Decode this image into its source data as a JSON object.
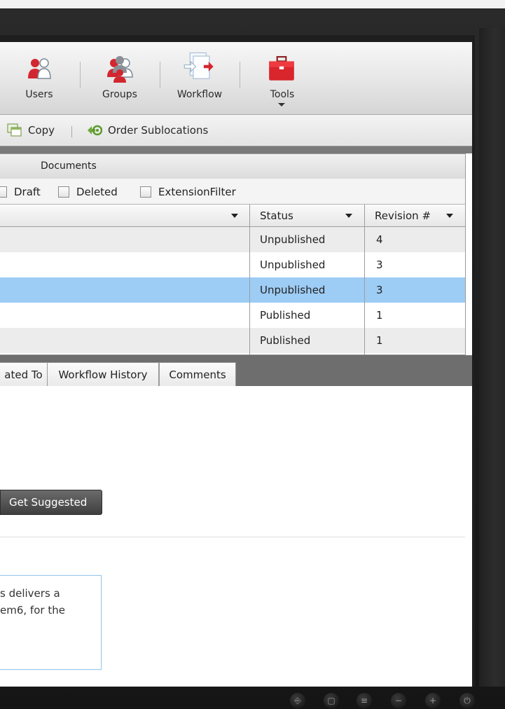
{
  "ribbon": {
    "users_label": "Users",
    "groups_label": "Groups",
    "workflow_label": "Workflow",
    "tools_label": "Tools",
    "tools_icon": "toolbox-icon",
    "users_icon": "users-icon",
    "groups_icon": "groups-icon",
    "workflow_icon": "workflow-icon"
  },
  "toolbar": {
    "copy_label": "Copy",
    "order_sublocations_label": "Order Sublocations"
  },
  "documents": {
    "header": "Documents",
    "filters": [
      {
        "label": "Draft",
        "checked": false
      },
      {
        "label": "Deleted",
        "checked": false
      },
      {
        "label": "ExtensionFilter",
        "checked": false
      }
    ],
    "columns": {
      "status": "Status",
      "revision": "Revision #"
    },
    "rows": [
      {
        "status": "Unpublished",
        "revision": "4",
        "selected": false
      },
      {
        "status": "Unpublished",
        "revision": "3",
        "selected": false
      },
      {
        "status": "Unpublished",
        "revision": "3",
        "selected": true
      },
      {
        "status": "Published",
        "revision": "1",
        "selected": false
      },
      {
        "status": "Published",
        "revision": "1",
        "selected": false
      }
    ]
  },
  "tabs": [
    "ated To",
    "Workflow History",
    "Comments"
  ],
  "content": {
    "get_suggested_label": "Get Suggested",
    "text_lines": [
      "s delivers a",
      "em6, for the"
    ]
  },
  "colors": {
    "selected_row": "#9dccf5",
    "alt_row": "#ececec",
    "accent_red": "#d22630"
  }
}
